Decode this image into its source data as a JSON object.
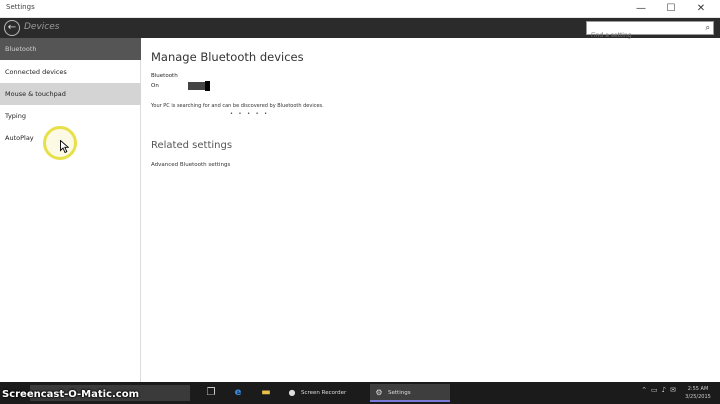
{
  "window": {
    "title": "Settings",
    "header_title": "Devices",
    "controls": {
      "minimize": "—",
      "maximize": "☐",
      "close": "✕"
    },
    "back_glyph": "←"
  },
  "search": {
    "placeholder": "Find a setting",
    "icon": "search-icon"
  },
  "sidebar": {
    "items": [
      {
        "label": "Bluetooth"
      },
      {
        "label": "Connected devices"
      },
      {
        "label": "Mouse & touchpad"
      },
      {
        "label": "Typing"
      },
      {
        "label": "AutoPlay"
      }
    ]
  },
  "main": {
    "title": "Manage Bluetooth devices",
    "bluetooth_label": "Bluetooth",
    "bluetooth_state": "On",
    "bluetooth_on": true,
    "searching_text": "Your PC is searching for and can be discovered by Bluetooth devices.",
    "progress_dots": "• • • • •",
    "related_title": "Related settings",
    "related_link": "Advanced Bluetooth settings"
  },
  "watermark": "Screencast-O-Matic.com",
  "taskbar": {
    "apps": [
      {
        "label": "Screen Recorder",
        "icon": "record-icon"
      },
      {
        "label": "Settings",
        "icon": "gear-icon"
      }
    ],
    "clock": {
      "time": "2:55 AM",
      "date": "3/25/2015"
    }
  },
  "colors": {
    "header": "#2b2b2b",
    "sidebar_header": "#555555",
    "selected": "#d4d4d4",
    "cursor_highlight": "#e8e04a"
  }
}
